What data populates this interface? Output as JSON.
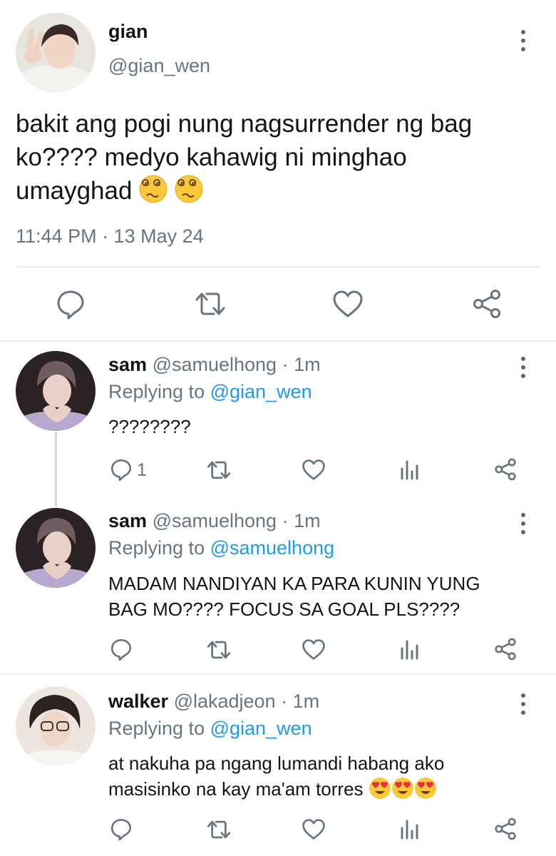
{
  "main_tweet": {
    "name": "gian",
    "handle": "@gian_wen",
    "text_line1": "bakit ang pogi nung nagsurrender ng bag",
    "text_line2": "ko???? medyo kahawig ni minghao",
    "text_line3": "umayghad",
    "emojis": [
      "woozy-face",
      "woozy-face"
    ],
    "timestamp": "11:44 PM · 13 May 24",
    "actions": [
      "reply-icon",
      "retweet-icon",
      "like-icon",
      "share-icon"
    ]
  },
  "replies": [
    {
      "name": "sam",
      "handle": "@samuelhong",
      "time": "· 1m",
      "replying_label": "Replying to",
      "replying_to": "@gian_wen",
      "text_line1": "????????",
      "reply_count": "1"
    },
    {
      "name": "sam",
      "handle": "@samuelhong",
      "time": "· 1m",
      "replying_label": "Replying to",
      "replying_to": "@samuelhong",
      "text_line1": "MADAM NANDIYAN KA PARA KUNIN YUNG",
      "text_line2": "BAG MO???? FOCUS SA GOAL PLS????"
    },
    {
      "name": "walker",
      "handle": "@lakadjeon",
      "time": "· 1m",
      "replying_label": "Replying to",
      "replying_to": "@gian_wen",
      "text_line1": "at nakuha pa ngang lumandi habang ako",
      "text_line2": "masisinko na kay ma'am torres",
      "emojis": [
        "heart-eyes-face",
        "heart-eyes-face",
        "heart-eyes-face"
      ]
    }
  ],
  "colors": {
    "link": "#1d9bf0",
    "muted": "#687580",
    "icon": "#687580",
    "divider": "#eceff1"
  }
}
